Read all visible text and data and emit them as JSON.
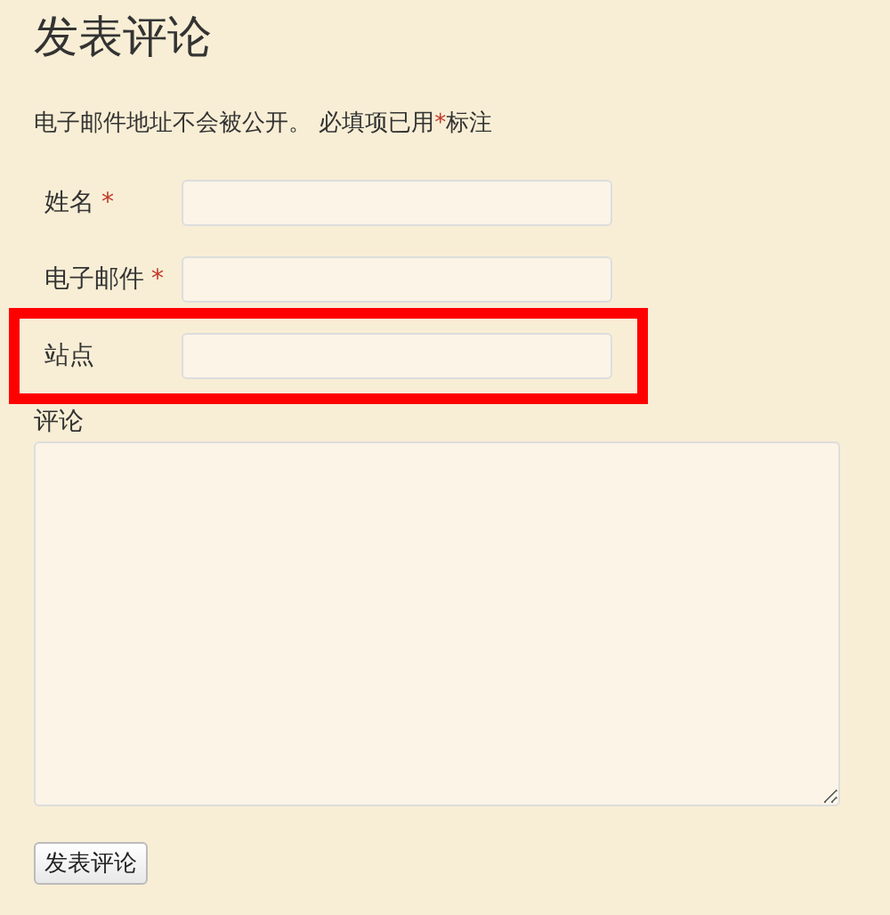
{
  "heading": "发表评论",
  "notice": {
    "text_before": "电子邮件地址不会被公开。 必填项已用",
    "mark": "*",
    "text_after": "标注"
  },
  "fields": [
    {
      "label": "姓名",
      "required_mark": "*",
      "highlighted": false
    },
    {
      "label": "电子邮件",
      "required_mark": "*",
      "highlighted": false
    },
    {
      "label": "站点",
      "highlighted": true
    }
  ],
  "comment": {
    "label": "评论"
  },
  "submit_button": "发表评论"
}
